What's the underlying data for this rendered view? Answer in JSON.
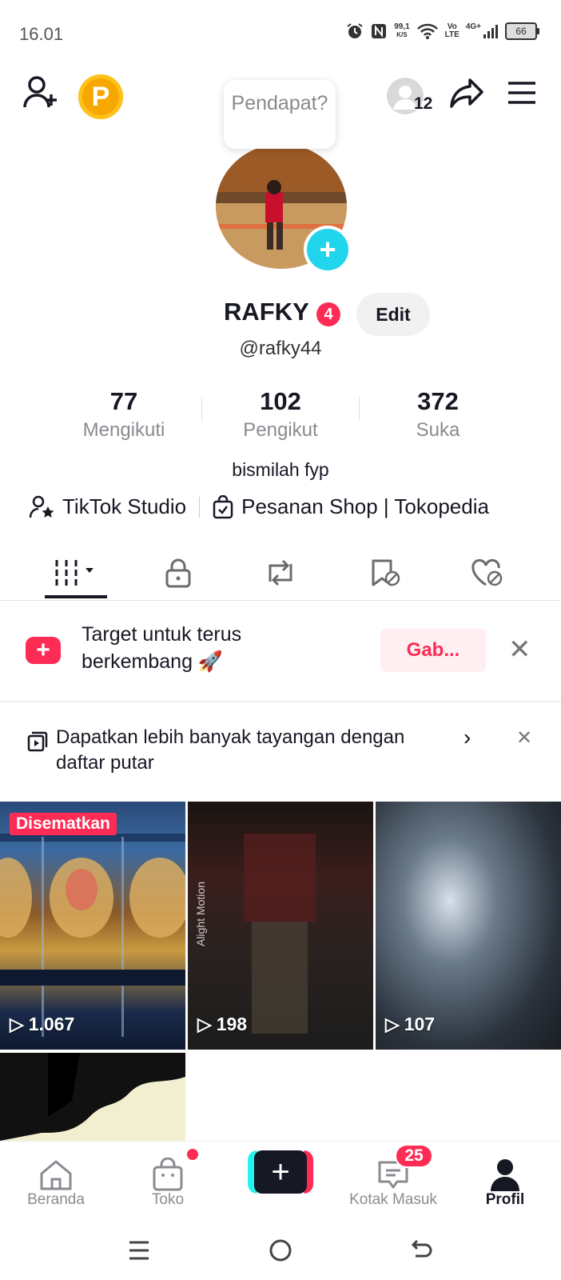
{
  "status_bar": {
    "time": "16.01",
    "speed_value": "99,1",
    "speed_unit": "K/S",
    "volte_top": "Vo",
    "volte_bottom": "LTE",
    "network": "4G+",
    "battery": "66"
  },
  "header": {
    "coin_letter": "P",
    "speech_bubble": "Pendapat?",
    "notification_count": "12",
    "icons": [
      "add-friend-icon",
      "share-icon",
      "menu-icon"
    ]
  },
  "profile": {
    "name": "RAFKY",
    "name_badge": "4",
    "edit_label": "Edit",
    "handle": "@rafky44",
    "bio": "bismilah fyp"
  },
  "stats": [
    {
      "value": "77",
      "label": "Mengikuti"
    },
    {
      "value": "102",
      "label": "Pengikut"
    },
    {
      "value": "372",
      "label": "Suka"
    }
  ],
  "links": {
    "studio": "TikTok Studio",
    "shop": "Pesanan Shop | Tokopedia"
  },
  "tabs": [
    "videos-grid-icon",
    "lock-icon",
    "repost-icon",
    "favorites-icon",
    "liked-icon"
  ],
  "banner": {
    "text": "Target untuk terus berkembang 🚀",
    "button": "Gab..."
  },
  "playlist_tip": {
    "text": "Dapatkan lebih banyak tayangan dengan daftar putar"
  },
  "videos": [
    {
      "views": "1.067",
      "pinned_label": "Disematkan"
    },
    {
      "views": "198",
      "watermark": "Alight Motion"
    },
    {
      "views": "107"
    },
    {
      "views": ""
    }
  ],
  "bottom_nav": {
    "home": "Beranda",
    "shop": "Toko",
    "inbox": "Kotak Masuk",
    "inbox_badge": "25",
    "profile": "Profil"
  },
  "colors": {
    "accent": "#fe2c55",
    "cyan": "#20d5ec",
    "text": "#161823",
    "muted": "#8a8b91"
  }
}
